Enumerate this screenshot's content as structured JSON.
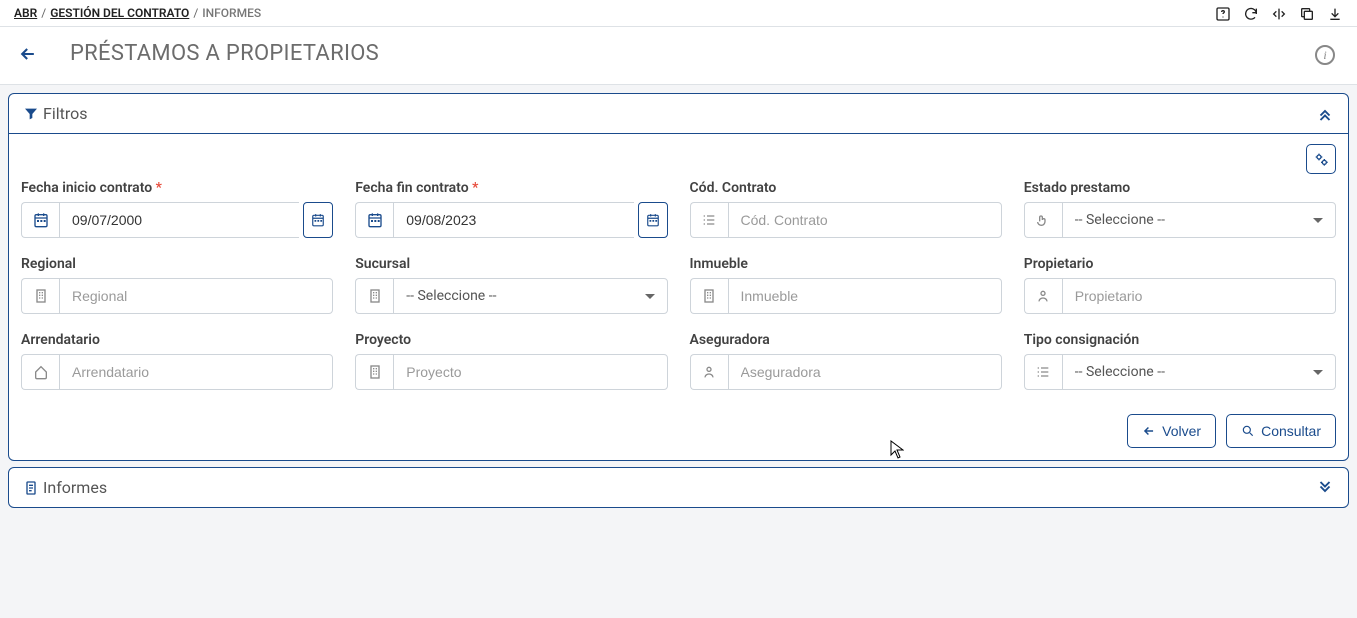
{
  "breadcrumb": {
    "root": "ABR",
    "section": "GESTIÓN DEL CONTRATO",
    "current": "INFORMES"
  },
  "page": {
    "title": "PRÉSTAMOS A PROPIETARIOS"
  },
  "panels": {
    "filters": {
      "title": "Filtros"
    },
    "reports": {
      "title": "Informes"
    }
  },
  "fields": {
    "fecha_inicio": {
      "label": "Fecha inicio contrato",
      "value": "09/07/2000"
    },
    "fecha_fin": {
      "label": "Fecha fin contrato",
      "value": "09/08/2023"
    },
    "cod_contrato": {
      "label": "Cód. Contrato",
      "placeholder": "Cód. Contrato"
    },
    "estado": {
      "label": "Estado prestamo",
      "value": "-- Seleccione --"
    },
    "regional": {
      "label": "Regional",
      "placeholder": "Regional"
    },
    "sucursal": {
      "label": "Sucursal",
      "value": "-- Seleccione --"
    },
    "inmueble": {
      "label": "Inmueble",
      "placeholder": "Inmueble"
    },
    "propietario": {
      "label": "Propietario",
      "placeholder": "Propietario"
    },
    "arrendatario": {
      "label": "Arrendatario",
      "placeholder": "Arrendatario"
    },
    "proyecto": {
      "label": "Proyecto",
      "placeholder": "Proyecto"
    },
    "aseguradora": {
      "label": "Aseguradora",
      "placeholder": "Aseguradora"
    },
    "tipo_consig": {
      "label": "Tipo consignación",
      "value": "-- Seleccione --"
    }
  },
  "buttons": {
    "volver": "Volver",
    "consultar": "Consultar"
  }
}
